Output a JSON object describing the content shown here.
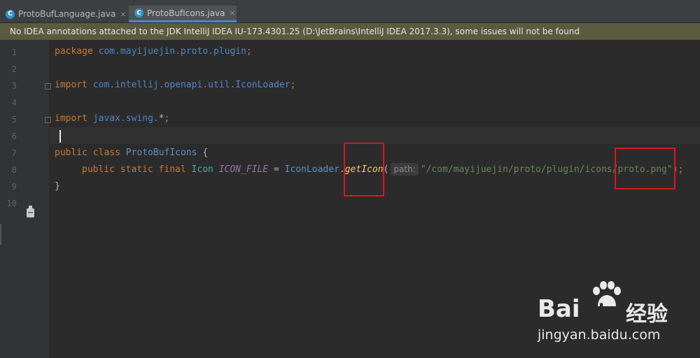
{
  "tabs": [
    {
      "label": "ProtoBufLanguage.java",
      "icon": "class-file-icon",
      "close": "×",
      "active": false
    },
    {
      "label": "ProtoBufIcons.java",
      "icon": "class-file-icon",
      "close": "×",
      "active": true
    }
  ],
  "tab_icon_letter": "C",
  "banner": {
    "text": "No IDEA annotations attached to the JDK IntelliJ IDEA IU-173.4301.25 (D:\\JetBrains\\IntelliJ IDEA 2017.3.3), some issues will not be found"
  },
  "line_numbers": [
    "1",
    "2",
    "3",
    "4",
    "5",
    "6",
    "7",
    "8",
    "9",
    "10"
  ],
  "code": {
    "l1": {
      "kw": "package",
      "pkg": "com.mayijuejin.proto.plugin",
      "semi": ";"
    },
    "l3": {
      "kw": "import",
      "pkg": "com.intellij.openapi.util.IconLoader",
      "semi": ";"
    },
    "l5": {
      "kw": "import",
      "pkg": "javax.swing.",
      "star": "*",
      "semi": ";"
    },
    "l7": {
      "kw": "public class",
      "cls": "ProtoBufIcons",
      "brace": "{"
    },
    "l8": {
      "kw": "public static final",
      "type": "Icon",
      "field": "ICON_FILE",
      "eq": "=",
      "loader": "IconLoader",
      "dot": ".",
      "method": "getIcon",
      "paren_open": "(",
      "hint": "path:",
      "string": "\"/com/mayijuejin/proto/plugin/icons/proto.png\"",
      "close": ");"
    },
    "l9": {
      "brace": "}"
    }
  },
  "watermark": {
    "brand_latin": "Bai",
    "brand_du": "du",
    "brand_cn": "经验",
    "url": "jingyan.baidu.com"
  },
  "colors": {
    "highlight_box": "#e0141e",
    "banner_bg": "#5a5a3e",
    "editor_bg": "#2b2b2b",
    "tab_accent": "#4a88c7"
  }
}
